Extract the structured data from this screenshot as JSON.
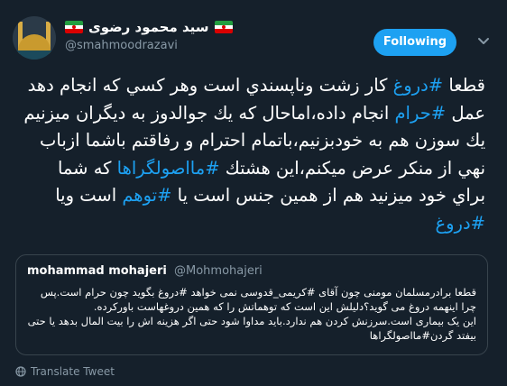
{
  "author": {
    "display_name": "سید محمود رضوی",
    "handle": "@smahmoodrazavi"
  },
  "follow_button": {
    "label": "Following"
  },
  "tweet": {
    "segments": [
      {
        "text": "قطعا ",
        "tag": false
      },
      {
        "text": "#دروغ",
        "tag": true
      },
      {
        "text": " كار زشت وناپسندي است وهر كسي كه انجام دهد عمل ",
        "tag": false
      },
      {
        "text": "#حرام",
        "tag": true
      },
      {
        "text": " انجام داده،اماحال كه يك جوالدوز به ديگران ميزنيم يك سوزن هم به خودبزنيم،باتمام احترام و رفاقتم باشما ازباب نهي از منكر عرض ميكنم،اين هشتك ",
        "tag": false
      },
      {
        "text": "#مااصولگراها",
        "tag": true
      },
      {
        "text": " كه شما براي خود ميزنيد هم از همين جنس است يا ",
        "tag": false
      },
      {
        "text": "#توهم",
        "tag": true
      },
      {
        "text": " است ويا ",
        "tag": false
      },
      {
        "text": "#دروغ",
        "tag": true
      }
    ]
  },
  "quoted_tweet": {
    "name": "mohammad mohajeri",
    "handle": "@Mohmohajeri",
    "text": "قطعا برادرمسلمان مومنی چون آقای #کریمی_قدوسی نمی خواهد #دروغ بگوید چون حرام است.پس چرا اینهمه دروغ می گوید؟دلیلش این است که توهماتش را که همین دروغهاست باورکرده.\nاین یک بیماری است.سرزنش کردن هم ندارد.باید مداوا شود حتی اگر هزینه اش را بیت المال بدهد یا حتی بیفتد گردن#مااصولگراها"
  },
  "translate": {
    "label": "Translate Tweet",
    "icon": "globe-icon"
  },
  "icons": {
    "caret": "chevron-down-icon",
    "flag": "iran-flag-icon"
  },
  "colors": {
    "background": "#15202b",
    "accent": "#1da1f2",
    "muted": "#8899a6",
    "border": "#38444d"
  }
}
